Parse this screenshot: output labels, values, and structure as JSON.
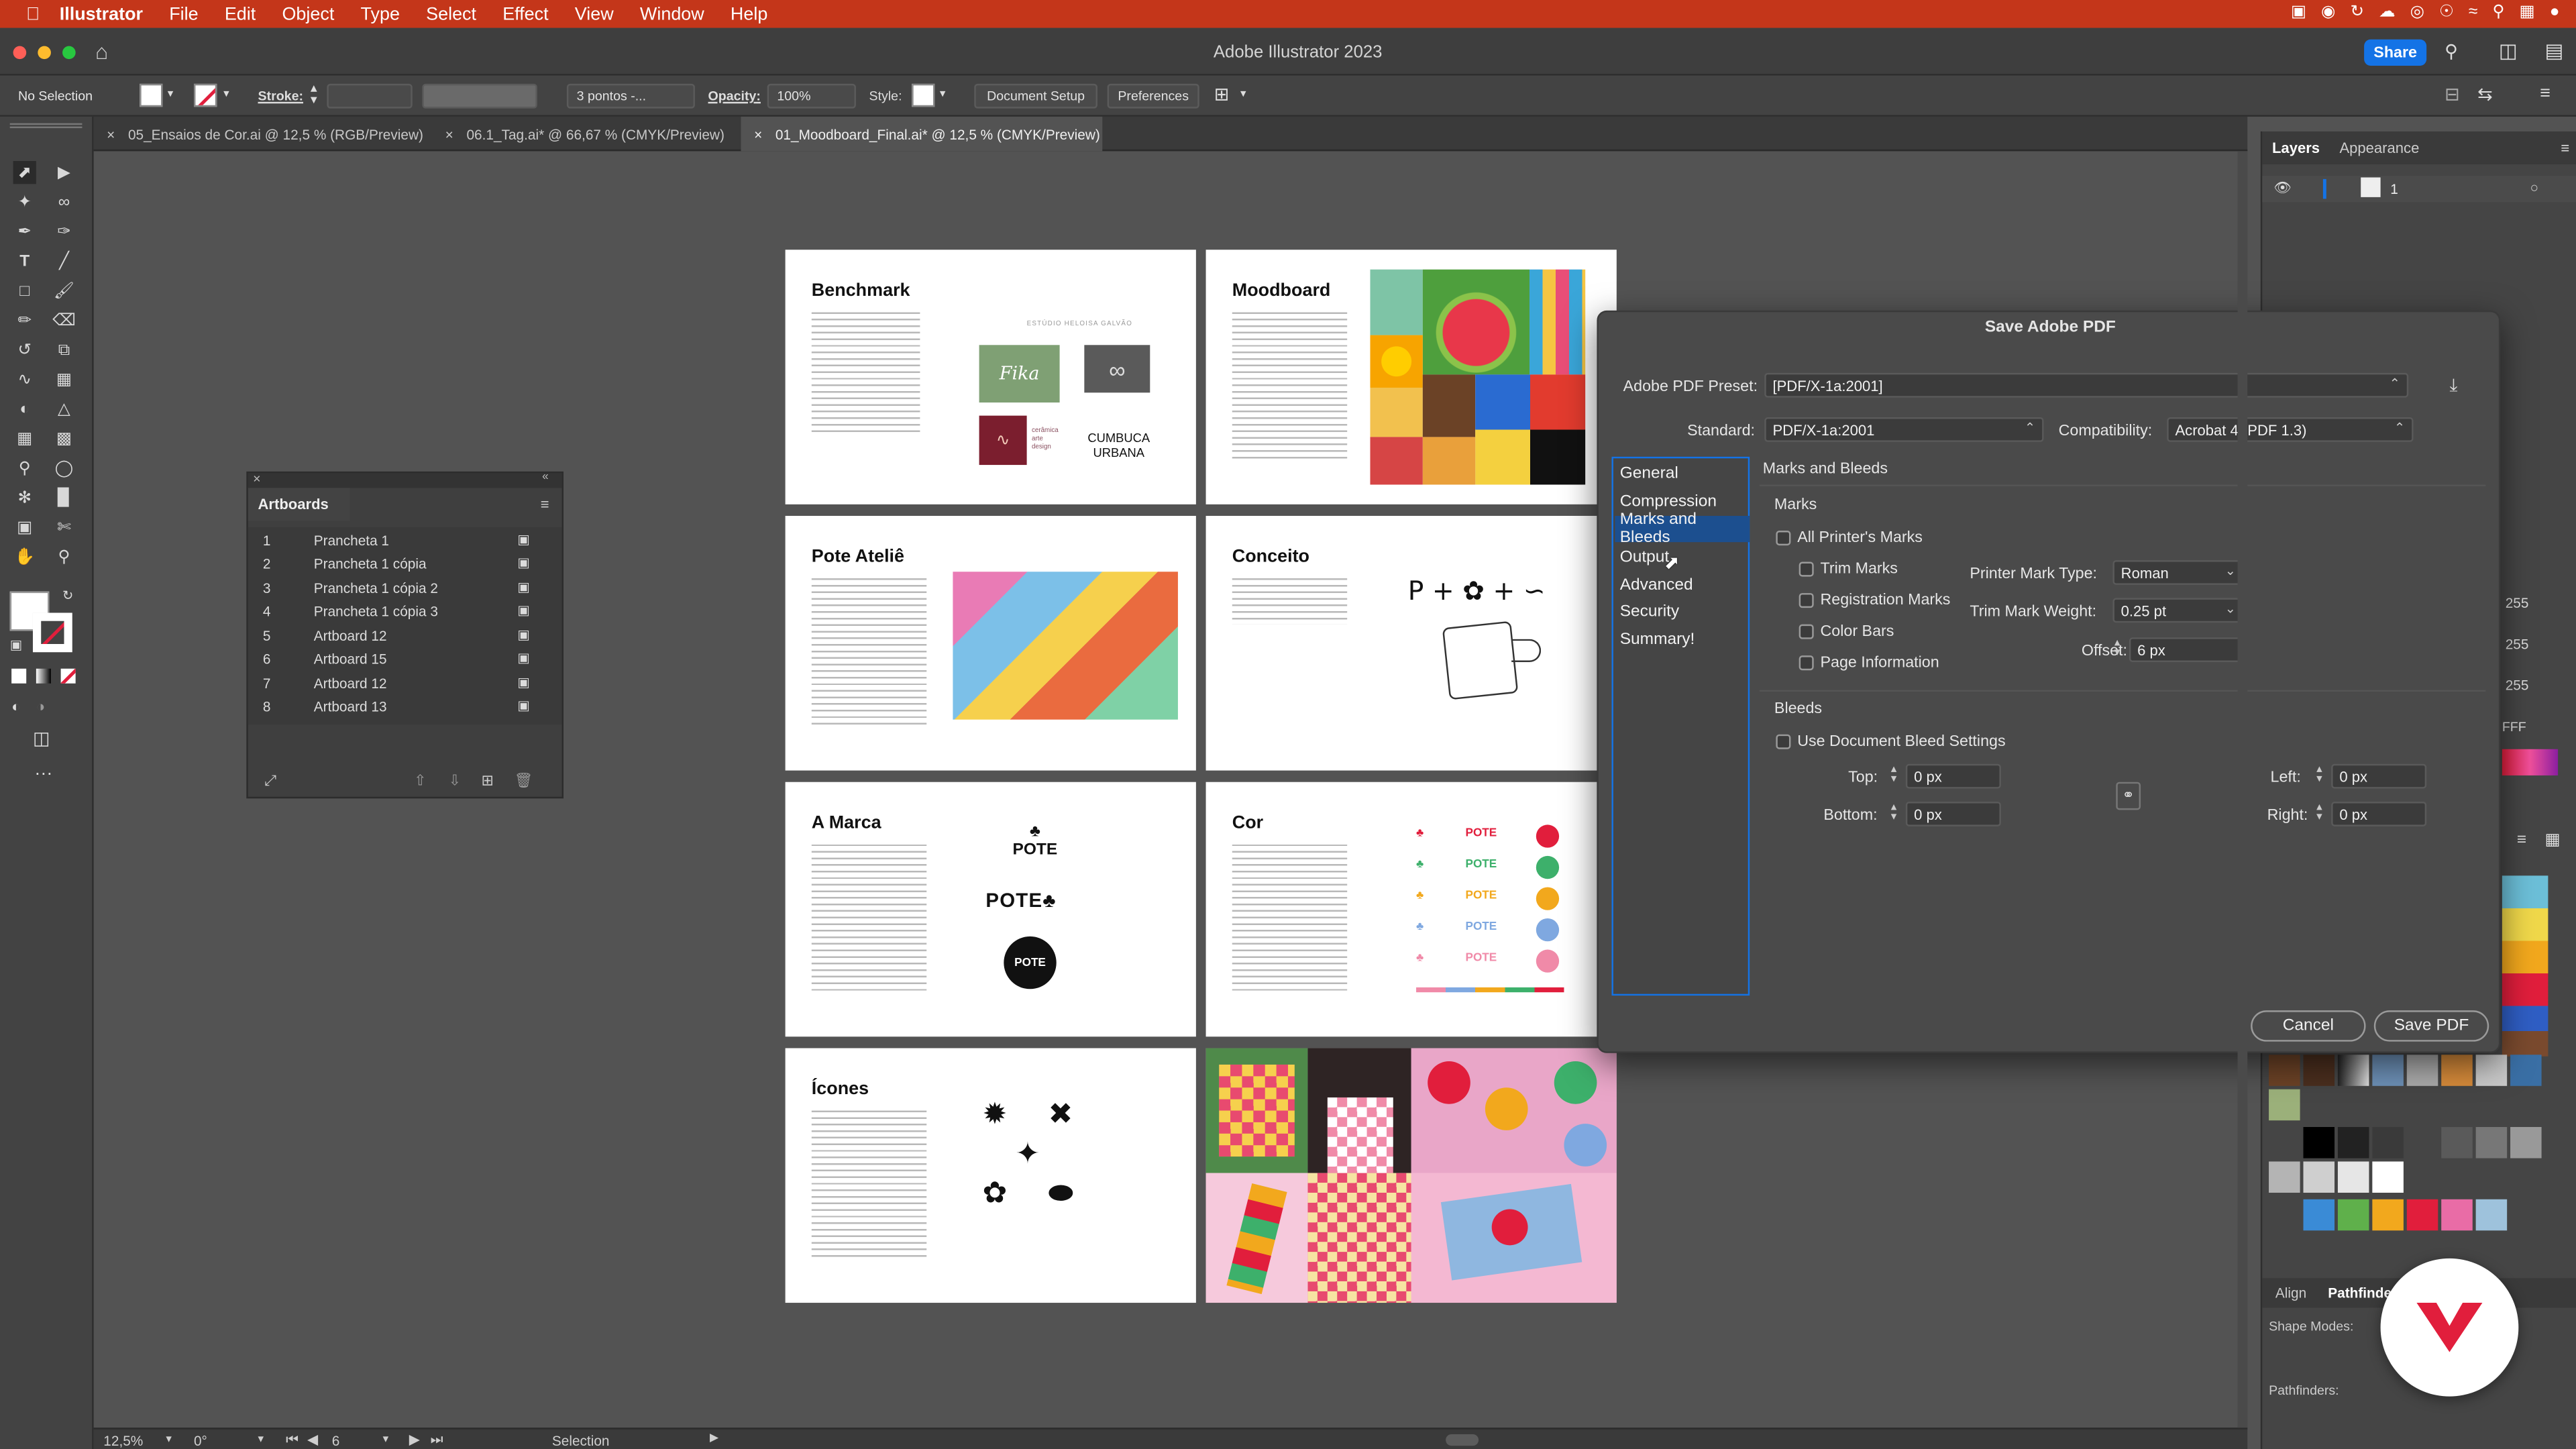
{
  "menubar": {
    "apple": "",
    "app": "Illustrator",
    "items": [
      "File",
      "Edit",
      "Object",
      "Type",
      "Select",
      "Effect",
      "View",
      "Window",
      "Help"
    ]
  },
  "window": {
    "title": "Adobe Illustrator 2023",
    "share": "Share"
  },
  "control_bar": {
    "selection": "No Selection",
    "stroke_label": "Stroke:",
    "brush": "3 pontos -...",
    "opacity_label": "Opacity:",
    "opacity_value": "100%",
    "style_label": "Style:",
    "document_setup": "Document Setup",
    "preferences": "Preferences"
  },
  "tabs": [
    {
      "label": "05_Ensaios de Cor.ai @ 12,5 % (RGB/Preview)",
      "active": false
    },
    {
      "label": "06.1_Tag.ai* @ 66,67 % (CMYK/Preview)",
      "active": false
    },
    {
      "label": "01_Moodboard_Final.ai* @ 12,5 % (CMYK/Preview)",
      "active": true
    }
  ],
  "artboards_canvas": [
    {
      "title": "Benchmark",
      "brand_caption": "ESTÚDIO HELOISA GALVÃO",
      "logo_text": "CUMBUCA URBANA",
      "logo_sub": "cerâmica arte design"
    },
    {
      "title": "Moodboard"
    },
    {
      "title": "Pote Ateliê"
    },
    {
      "title": "Conceito",
      "formula": "P +"
    },
    {
      "title": "A Marca",
      "logo_word": "POTE"
    },
    {
      "title": "Cor",
      "logo_word": "POTE"
    },
    {
      "title": "Ícones"
    },
    {
      "title": ""
    }
  ],
  "artboards_panel": {
    "title": "Artboards",
    "rows": [
      {
        "num": "1",
        "name": "Prancheta 1"
      },
      {
        "num": "2",
        "name": "Prancheta 1 cópia"
      },
      {
        "num": "3",
        "name": "Prancheta 1 cópia 2"
      },
      {
        "num": "4",
        "name": "Prancheta 1 cópia 3"
      },
      {
        "num": "5",
        "name": "Artboard 12"
      },
      {
        "num": "6",
        "name": "Artboard 15"
      },
      {
        "num": "7",
        "name": "Artboard 12"
      },
      {
        "num": "8",
        "name": "Artboard 13"
      }
    ]
  },
  "right_panel": {
    "tabs": [
      "Layers",
      "Appearance"
    ],
    "layer_name": "1",
    "color_values": [
      "255",
      "255",
      "255"
    ],
    "hex": "FFF",
    "bottom_tabs": [
      "Align",
      "Pathfinder"
    ],
    "shape_modes": "Shape Modes:",
    "pathfinders": "Pathfinders:"
  },
  "dialog": {
    "title": "Save Adobe PDF",
    "preset_label": "Adobe PDF Preset:",
    "preset_value": "[PDF/X-1a:2001]",
    "standard_label": "Standard:",
    "standard_value": "PDF/X-1a:2001",
    "compat_label": "Compatibility:",
    "compat_value": "Acrobat 4 (PDF 1.3)",
    "nav": [
      "General",
      "Compression",
      "Marks and Bleeds",
      "Output",
      "Advanced",
      "Security",
      "Summary"
    ],
    "nav_selected": "Marks and Bleeds",
    "section_title": "Marks and Bleeds",
    "marks_title": "Marks",
    "all_printers_marks": "All Printer's Marks",
    "trim_marks": "Trim Marks",
    "registration_marks": "Registration Marks",
    "color_bars": "Color Bars",
    "page_information": "Page Information",
    "printer_mark_type_label": "Printer Mark Type:",
    "printer_mark_type": "Roman",
    "trim_mark_weight_label": "Trim Mark Weight:",
    "trim_mark_weight": "0.25 pt",
    "offset_label": "Offset:",
    "offset": "6 px",
    "bleeds_title": "Bleeds",
    "use_doc_bleed": "Use Document Bleed Settings",
    "top_label": "Top:",
    "top": "0 px",
    "bottom_label": "Bottom:",
    "bottom": "0 px",
    "left_label": "Left:",
    "left": "0 px",
    "right_label": "Right:",
    "right": "0 px",
    "cancel": "Cancel",
    "save": "Save PDF"
  },
  "status": {
    "zoom": "12,5%",
    "rotation": "0°",
    "artboard": "6",
    "tool": "Selection"
  },
  "colors": {
    "menubar": "#c4361a",
    "accent": "#1473e6",
    "dialog_bg": "#4a4a4a",
    "badge_red": "#e11e3c"
  }
}
